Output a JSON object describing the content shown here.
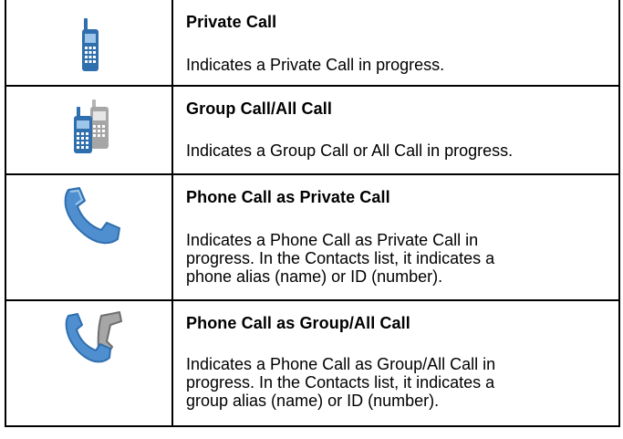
{
  "rows": [
    {
      "icon": "portable-radio-icon",
      "title": "Private Call",
      "description": "Indicates a Private Call in progress."
    },
    {
      "icon": "group-radios-icon",
      "title": "Group Call/All Call",
      "description": "Indicates a Group Call or All Call in progress."
    },
    {
      "icon": "phone-handset-icon",
      "title": "Phone Call as Private Call",
      "description_lines": [
        "Indicates a Phone Call as Private Call in",
        "progress. In the Contacts list, it indicates a",
        "phone alias (name) or ID (number)."
      ]
    },
    {
      "icon": "phone-group-handsets-icon",
      "title": "Phone Call as Group/All Call",
      "description_lines": [
        "Indicates a Phone Call as Group/All Call in",
        "progress. In the Contacts list, it indicates a",
        "group alias (name) or ID (number)."
      ]
    }
  ],
  "colors": {
    "icon_blue": "#2f6fae",
    "icon_blue_light": "#5b9bd5",
    "icon_gray": "#8c8c8c",
    "border": "#000000"
  }
}
